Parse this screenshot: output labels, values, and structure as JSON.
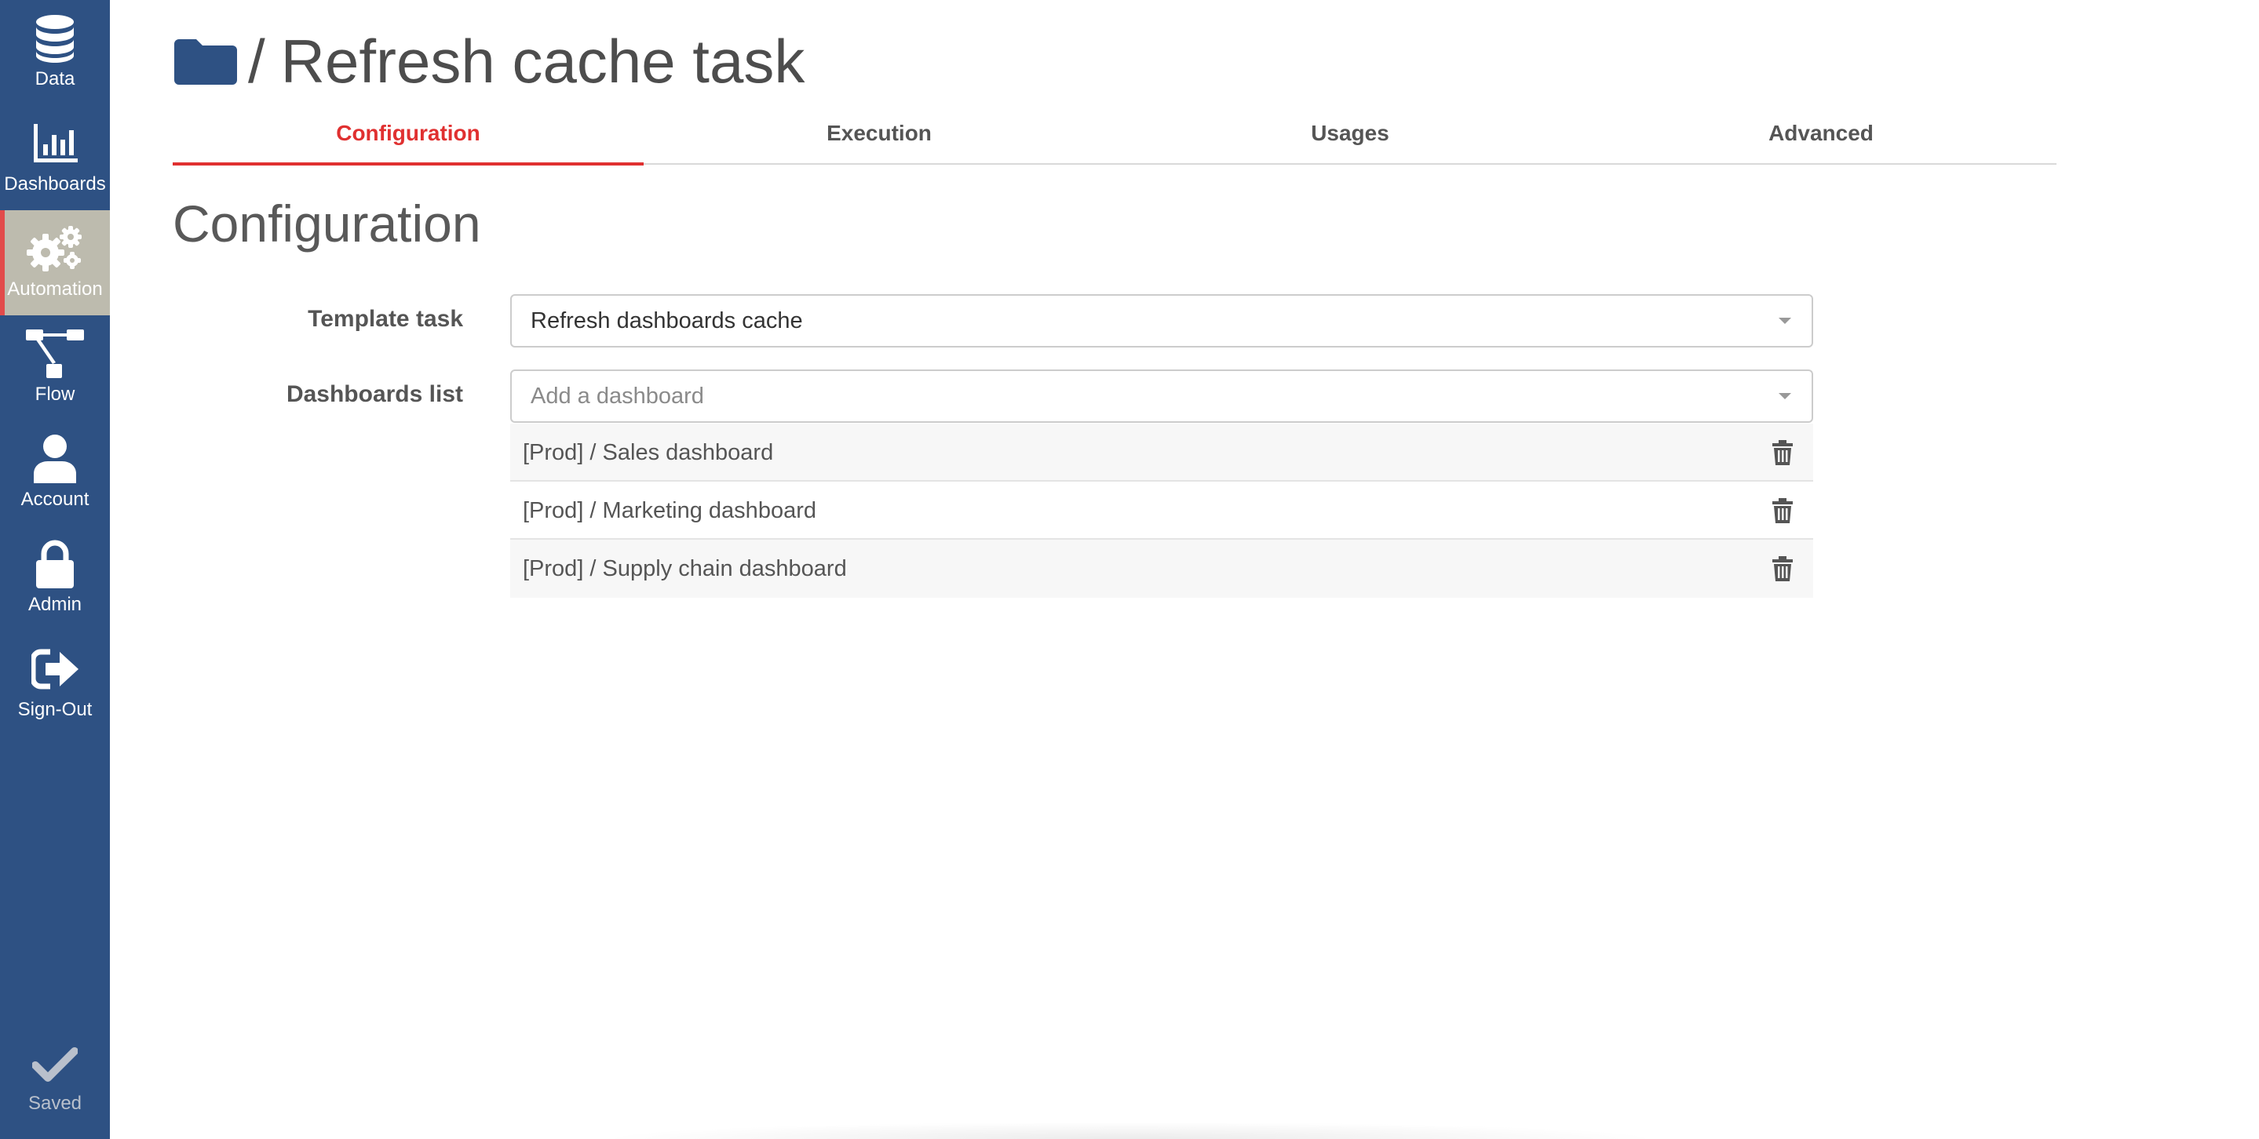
{
  "sidebar": {
    "items": [
      {
        "label": "Data",
        "icon": "database-icon"
      },
      {
        "label": "Dashboards",
        "icon": "bar-chart-icon"
      },
      {
        "label": "Automation",
        "icon": "gears-icon",
        "active": true
      },
      {
        "label": "Flow",
        "icon": "sitemap-icon"
      },
      {
        "label": "Account",
        "icon": "user-icon"
      },
      {
        "label": "Admin",
        "icon": "lock-icon"
      },
      {
        "label": "Sign-Out",
        "icon": "sign-out-icon"
      }
    ],
    "status": {
      "label": "Saved",
      "icon": "checkmark-icon"
    }
  },
  "header": {
    "separator": "/",
    "title": "Refresh cache task",
    "icon": "folder-icon"
  },
  "tabs": [
    {
      "label": "Configuration",
      "active": true
    },
    {
      "label": "Execution"
    },
    {
      "label": "Usages"
    },
    {
      "label": "Advanced"
    }
  ],
  "section": {
    "title": "Configuration"
  },
  "form": {
    "template_task": {
      "label": "Template task",
      "value": "Refresh dashboards cache"
    },
    "dashboards_list": {
      "label": "Dashboards list",
      "placeholder": "Add a dashboard",
      "items": [
        "[Prod] / Sales dashboard",
        "[Prod] / Marketing dashboard",
        "[Prod] / Supply chain dashboard"
      ]
    }
  },
  "colors": {
    "sidebar_bg": "#2e5183",
    "active_item_bg": "#bdbbae",
    "accent_red": "#e03030",
    "folder_blue": "#2e5183"
  }
}
